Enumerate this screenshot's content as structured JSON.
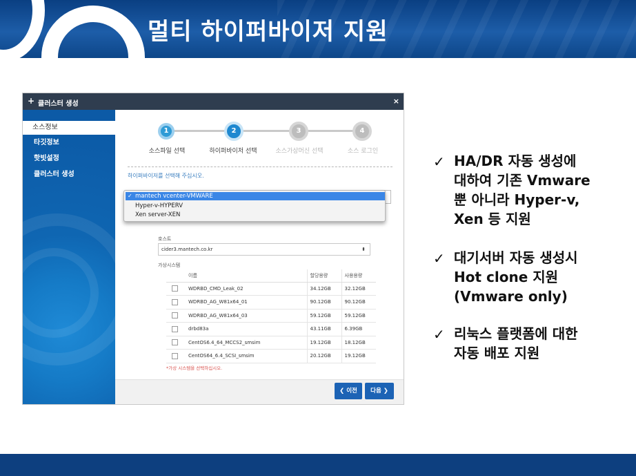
{
  "slide": {
    "title": "멀티 하이퍼바이저 지원",
    "bullets": [
      {
        "lines": [
          "HA/DR 자동 생성에",
          "대하여 기존 Vmware",
          "뿐 아니라 Hyper-v,",
          "Xen 등 지원"
        ]
      },
      {
        "lines": [
          "대기서버 자동 생성시",
          "Hot clone 지원",
          "(Vmware only)"
        ]
      },
      {
        "lines": [
          "리눅스 플랫폼에 대한",
          "자동 배포 지원"
        ]
      }
    ],
    "check_glyph": "✓"
  },
  "window": {
    "title": "클러스터 생성",
    "plus_icon": "+",
    "close_icon": "×",
    "sidebar": {
      "items": [
        {
          "label": "소스정보",
          "active": true
        },
        {
          "label": "타깃정보",
          "active": false
        },
        {
          "label": "핫빗설정",
          "active": false
        },
        {
          "label": "클러스터 생성",
          "active": false
        }
      ]
    },
    "steps": [
      {
        "num": "1",
        "label": "소스파일 선택",
        "state": "done"
      },
      {
        "num": "2",
        "label": "하이퍼바이저 선택",
        "state": "current"
      },
      {
        "num": "3",
        "label": "소스가상머신 선택",
        "state": "todo"
      },
      {
        "num": "4",
        "label": "소스 로그인",
        "state": "todo"
      }
    ],
    "instruction": "하이퍼바이저를 선택해 주십시오.",
    "dropdown": {
      "check": "✓",
      "options": [
        "mantech vcenter-VMWARE",
        "Hyper-v-HYPERV",
        "Xen server-XEN"
      ],
      "selected_index": 0
    },
    "host": {
      "label": "호스트",
      "value": "cider3.mantech.co.kr",
      "arrow": "⬍"
    },
    "vm_section_label": "가상시스템",
    "vm_table": {
      "headers": [
        "",
        "이름",
        "할당용량",
        "사용용량"
      ],
      "rows": [
        [
          "WDRBD_CMD_Leak_02",
          "34.12GB",
          "32.12GB"
        ],
        [
          "WDRBD_AG_W81x64_01",
          "90.12GB",
          "90.12GB"
        ],
        [
          "WDRBD_AG_W81x64_03",
          "59.12GB",
          "59.12GB"
        ],
        [
          "drbd83a",
          "43.11GB",
          "6.39GB"
        ],
        [
          "CentOS6.4_64_MCCS2_smsim",
          "19.12GB",
          "18.12GB"
        ],
        [
          "CentOS64_6.4_SCSI_smsim",
          "20.12GB",
          "19.12GB"
        ]
      ]
    },
    "warning": "*가상 시스템을 선택하십시오.",
    "buttons": {
      "prev": "❮ 이전",
      "next": "다음 ❯"
    }
  }
}
